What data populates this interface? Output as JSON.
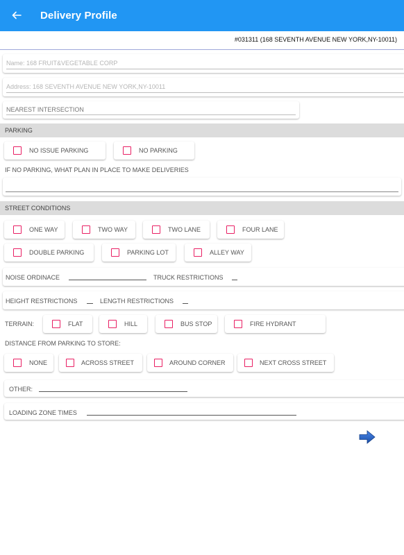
{
  "appbar": {
    "title": "Delivery Profile",
    "back_icon": "arrow-left-icon",
    "color": "#2196f3"
  },
  "store_id": "#031311 (168 SEVENTH AVENUE NEW YORK,NY-10011)",
  "fields": {
    "name": "Name: 168 FRUIT&VEGETABLE CORP",
    "address": "Address: 168 SEVENTH AVENUE NEW YORK,NY-10011",
    "nearest_intersection_placeholder": "NEAREST INTERSECTION"
  },
  "parking": {
    "header": "PARKING",
    "options": [
      "NO ISSUE PARKING",
      "NO PARKING"
    ],
    "question": "IF NO PARKING, WHAT PLAN IN PLACE TO MAKE DELIVERIES",
    "answer": ""
  },
  "street_conditions": {
    "header": "STREET CONDITIONS",
    "row1": [
      "ONE WAY",
      "TWO WAY",
      "TWO LANE",
      "FOUR LANE"
    ],
    "row2": [
      "DOUBLE PARKING",
      "PARKING LOT",
      "ALLEY WAY"
    ],
    "noise_label": "NOISE ORDINACE",
    "truck_label": "TRUCK RESTRICTIONS",
    "height_label": "HEIGHT RESTRICTIONS",
    "length_label": "LENGTH RESTRICTIONS",
    "terrain_label": "TERRAIN:",
    "terrain_options": [
      "FLAT",
      "HILL",
      "BUS STOP",
      "FIRE HYDRANT"
    ],
    "distance_label": "DISTANCE FROM PARKING TO STORE:",
    "distance_options": [
      "NONE",
      "ACROSS STREET",
      "AROUND CORNER",
      "NEXT CROSS STREET"
    ],
    "other_label": "OTHER:",
    "loading_label": "LOADING ZONE TIMES"
  },
  "colors": {
    "checkbox": "#e91e63",
    "next_arrow": "#1e5bb8"
  },
  "next_icon": "arrow-right-icon"
}
